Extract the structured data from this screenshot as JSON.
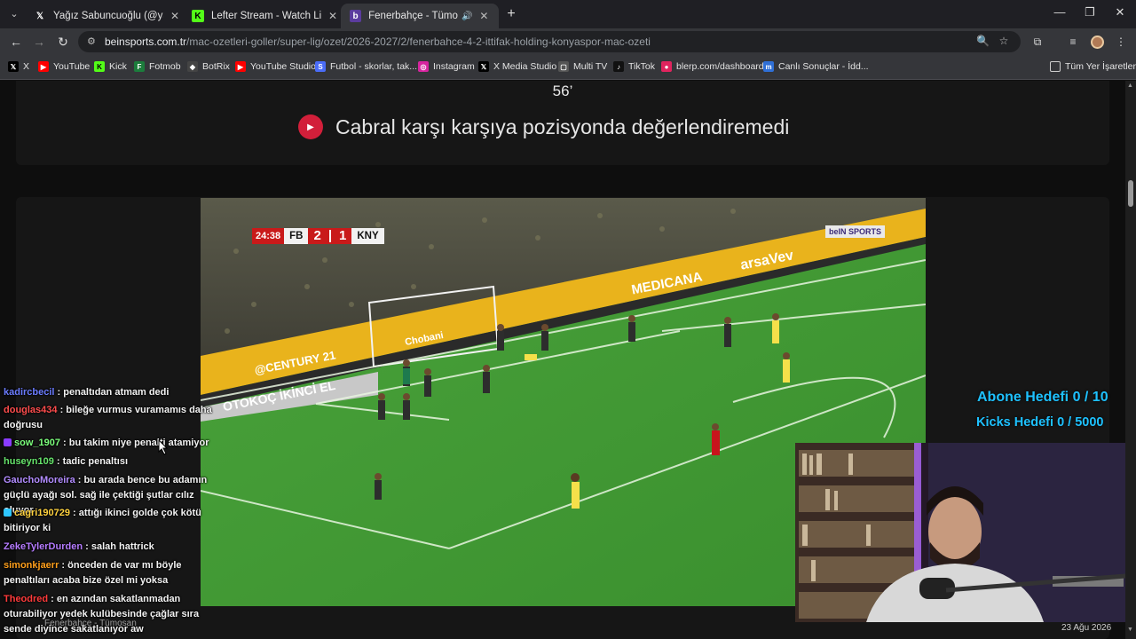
{
  "browser": {
    "tabs": [
      {
        "label": "Yağız Sabuncuoğlu (@yagosab",
        "icon": "x-icon",
        "active": false
      },
      {
        "label": "Lefter Stream - Watch Live on K",
        "icon": "kick-icon",
        "active": false
      },
      {
        "label": "Fenerbahçe - Tümosan Kon",
        "icon": "bein-icon",
        "active": true
      }
    ],
    "url_domain": "beinsports.com.tr",
    "url_path": "/mac-ozetleri-goller/super-lig/ozet/2026-2027/2/fenerbahce-4-2-ittifak-holding-konyaspor-mac-ozeti",
    "bookmarks": [
      {
        "label": "X",
        "color": "#000000"
      },
      {
        "label": "YouTube",
        "color": "#ff0000"
      },
      {
        "label": "Kick",
        "color": "#53fc18"
      },
      {
        "label": "Fotmob",
        "color": "#1c7c3c"
      },
      {
        "label": "BotRix",
        "color": "#444444"
      },
      {
        "label": "YouTube Studio",
        "color": "#ff0000"
      },
      {
        "label": "Futbol - skorlar, tak...",
        "color": "#4a6cf7"
      },
      {
        "label": "Instagram",
        "color": "#d6249f"
      },
      {
        "label": "X Media Studio",
        "color": "#000000"
      },
      {
        "label": "Multi TV",
        "color": "#555555"
      },
      {
        "label": "TikTok",
        "color": "#111111"
      },
      {
        "label": "blerp.com/dashboard",
        "color": "#e0245e"
      },
      {
        "label": "Canlı Sonuçlar - İdd...",
        "color": "#2f6fd6"
      }
    ],
    "all_bookmarks": "Tüm Yer İşaretleri"
  },
  "article": {
    "minute": "56’",
    "headline": "Cabral karşı karşıya pozisyonda değerlendiremedi"
  },
  "video": {
    "scorebug": {
      "time": "24:38",
      "home": "FB",
      "home_score": "2",
      "away_score": "1",
      "away": "KNY"
    },
    "broadcaster": "beIN SPORTS",
    "ads": [
      "@CENTURY 21",
      "MEDICANA",
      "arsaVev",
      "OTOKOÇ İKİNCİ EL",
      "Chobani"
    ]
  },
  "chat": [
    {
      "user": "kadircbecil",
      "user_color": "#6b7cff",
      "text": " : penaltıdan atmam dedi"
    },
    {
      "user": "douglas434",
      "user_color": "#ff4d4d",
      "text": " : bileğe vurmus vuramamıs daha doğrusu"
    },
    {
      "user": "sow_1907",
      "user_color": "#7cff7c",
      "text": " : bu takim niye penalti atamiyor",
      "badge": "#8a3cff"
    },
    {
      "user": "huseyn109",
      "user_color": "#66e36b",
      "text": " : tadic penaltısı"
    },
    {
      "user": "GauchoMoreira",
      "user_color": "#b28cff",
      "text": " : bu arada bence bu adamın güçlü ayağı sol. sağ ile çektiği şutlar cılız oluyor"
    },
    {
      "user": "cagri190729",
      "user_color": "#ffd23f",
      "text": " : attığı ikinci golde çok kötü bitiriyor ki",
      "badge": "#2ec6ff"
    },
    {
      "user": "ZekeTylerDurden",
      "user_color": "#b57bff",
      "text": " : salah hattrick"
    },
    {
      "user": "simonkjaerr",
      "user_color": "#ff9f1c",
      "text": " : önceden de var mı böyle penaltıları acaba bize özel mi yoksa"
    },
    {
      "user": "Theodred",
      "user_color": "#ff3b3b",
      "text": " : en azından sakatlanmadan oturabiliyor yedek kulübesinde çağlar sıra sende diyince sakatlanıyor aw"
    }
  ],
  "goals": {
    "subscriber_goal": "Abone Hedefi 0 / 10",
    "kicks_goal": "Kicks Hedefi 0 / 5000"
  },
  "taskbar": {
    "tab_label": "Fenerbahçe - Tümosan",
    "date": "23 Ağu 2026"
  }
}
